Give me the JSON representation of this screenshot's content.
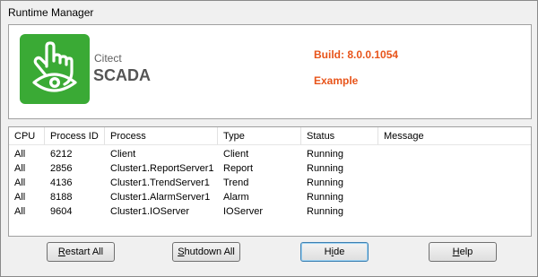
{
  "window": {
    "title": "Runtime Manager"
  },
  "header": {
    "brand_small": "Citect",
    "brand_big": "SCADA",
    "build": "Build: 8.0.0.1054",
    "project": "Example",
    "logo_icon": "hand-eye-icon",
    "logo_color": "#3aaa35",
    "accent_color": "#e8541a"
  },
  "table": {
    "columns": [
      "CPU",
      "Process ID",
      "Process",
      "Type",
      "Status",
      "Message"
    ],
    "rows": [
      [
        "All",
        "6212",
        "Client",
        "Client",
        "Running",
        ""
      ],
      [
        "All",
        "2856",
        "Cluster1.ReportServer1",
        "Report",
        "Running",
        ""
      ],
      [
        "All",
        "4136",
        "Cluster1.TrendServer1",
        "Trend",
        "Running",
        ""
      ],
      [
        "All",
        "8188",
        "Cluster1.AlarmServer1",
        "Alarm",
        "Running",
        ""
      ],
      [
        "All",
        "9604",
        "Cluster1.IOServer",
        "IOServer",
        "Running",
        ""
      ]
    ]
  },
  "buttons": {
    "restart": {
      "mnemonic": "R",
      "rest": "estart All"
    },
    "shutdown": {
      "mnemonic": "S",
      "rest": "hutdown All"
    },
    "hide": {
      "pre": "H",
      "mnemonic": "i",
      "rest": "de"
    },
    "help": {
      "mnemonic": "H",
      "rest": "elp"
    }
  }
}
